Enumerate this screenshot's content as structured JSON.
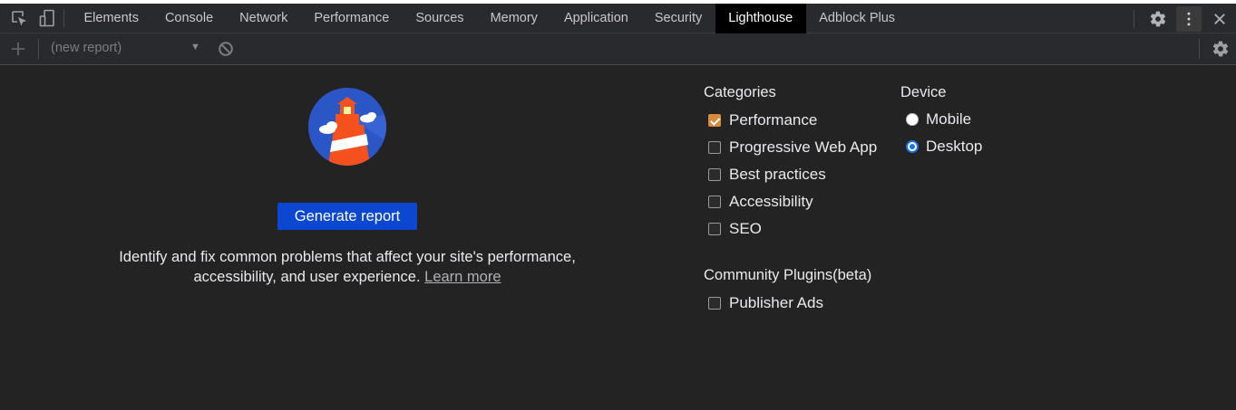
{
  "devtools": {
    "tabs": [
      {
        "label": "Elements"
      },
      {
        "label": "Console"
      },
      {
        "label": "Network"
      },
      {
        "label": "Performance"
      },
      {
        "label": "Sources"
      },
      {
        "label": "Memory"
      },
      {
        "label": "Application"
      },
      {
        "label": "Security"
      },
      {
        "label": "Lighthouse",
        "active": true
      },
      {
        "label": "Adblock Plus"
      }
    ]
  },
  "toolbar": {
    "report_select": "(new report)"
  },
  "main": {
    "generate_label": "Generate report",
    "description": "Identify and fix common problems that affect your site's performance, accessibility, and user experience.",
    "learn_more": "Learn more"
  },
  "categories": {
    "heading": "Categories",
    "items": [
      {
        "label": "Performance",
        "checked": true
      },
      {
        "label": "Progressive Web App",
        "checked": false
      },
      {
        "label": "Best practices",
        "checked": false
      },
      {
        "label": "Accessibility",
        "checked": false
      },
      {
        "label": "SEO",
        "checked": false
      }
    ]
  },
  "device": {
    "heading": "Device",
    "options": [
      {
        "label": "Mobile",
        "selected": false
      },
      {
        "label": "Desktop",
        "selected": true
      }
    ]
  },
  "plugins": {
    "heading": "Community Plugins(beta)",
    "items": [
      {
        "label": "Publisher Ads",
        "checked": false
      }
    ]
  },
  "colors": {
    "background": "#232323",
    "active_tab": "#000000",
    "primary_button": "#0b47d0",
    "checked_checkbox": "#d88b3c",
    "selected_radio": "#1a73e8"
  },
  "icons": [
    "inspect-element-icon",
    "device-toggle-icon",
    "settings-gear-icon",
    "more-options-icon",
    "close-icon",
    "add-icon",
    "dropdown-arrow-icon",
    "clear-icon",
    "lighthouse-logo"
  ]
}
